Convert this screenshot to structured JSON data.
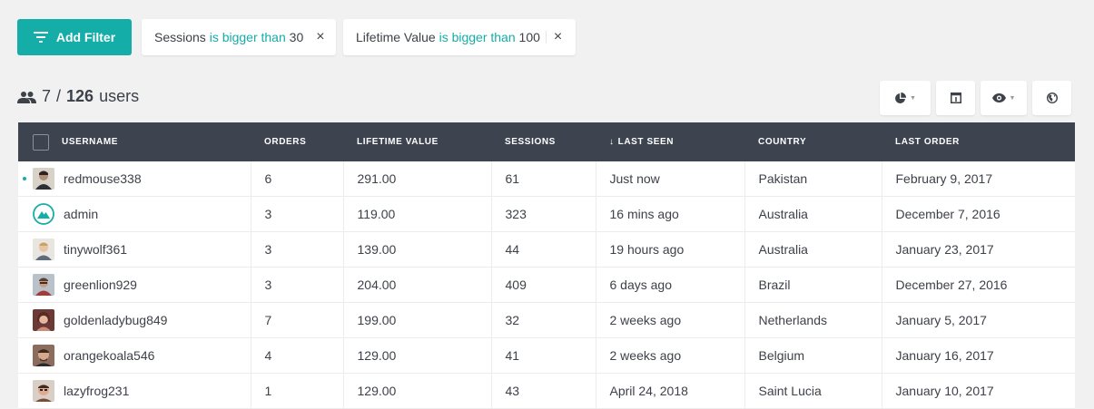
{
  "filters": {
    "add_label": "Add Filter",
    "items": [
      {
        "field": "Sessions",
        "op": "is bigger than",
        "value": "30"
      },
      {
        "field": "Lifetime Value",
        "op": "is bigger than",
        "value": "100"
      }
    ]
  },
  "count": {
    "shown": "7",
    "separator": "/",
    "total": "126",
    "unit": "users"
  },
  "table": {
    "columns": [
      "Username",
      "Orders",
      "Lifetime Value",
      "Sessions",
      "Last Seen",
      "Country",
      "Last Order"
    ],
    "sort_indicator": "↓",
    "rows": [
      {
        "username": "redmouse338",
        "orders": "6",
        "lifetime_value": "291.00",
        "sessions": "61",
        "last_seen": "Just now",
        "country": "Pakistan",
        "last_order": "February 9, 2017"
      },
      {
        "username": "admin",
        "orders": "3",
        "lifetime_value": "119.00",
        "sessions": "323",
        "last_seen": "16 mins ago",
        "country": "Australia",
        "last_order": "December 7, 2016"
      },
      {
        "username": "tinywolf361",
        "orders": "3",
        "lifetime_value": "139.00",
        "sessions": "44",
        "last_seen": "19 hours ago",
        "country": "Australia",
        "last_order": "January 23, 2017"
      },
      {
        "username": "greenlion929",
        "orders": "3",
        "lifetime_value": "204.00",
        "sessions": "409",
        "last_seen": "6 days ago",
        "country": "Brazil",
        "last_order": "December 27, 2016"
      },
      {
        "username": "goldenladybug849",
        "orders": "7",
        "lifetime_value": "199.00",
        "sessions": "32",
        "last_seen": "2 weeks ago",
        "country": "Netherlands",
        "last_order": "January 5, 2017"
      },
      {
        "username": "orangekoala546",
        "orders": "4",
        "lifetime_value": "129.00",
        "sessions": "41",
        "last_seen": "2 weeks ago",
        "country": "Belgium",
        "last_order": "January 16, 2017"
      },
      {
        "username": "lazyfrog231",
        "orders": "1",
        "lifetime_value": "129.00",
        "sessions": "43",
        "last_seen": "April 24, 2018",
        "country": "Saint Lucia",
        "last_order": "January 10, 2017"
      }
    ]
  },
  "icons": {
    "filter": "filter-icon",
    "users": "users-icon",
    "remove": "close-icon",
    "tool_buttons": [
      "pie-chart-icon",
      "columns-icon",
      "eye-icon",
      "globe-icon"
    ]
  },
  "colors": {
    "accent": "#14ada8",
    "header_bg": "#3d4450",
    "page_bg": "#f1f1f1",
    "text": "#3d4148"
  }
}
